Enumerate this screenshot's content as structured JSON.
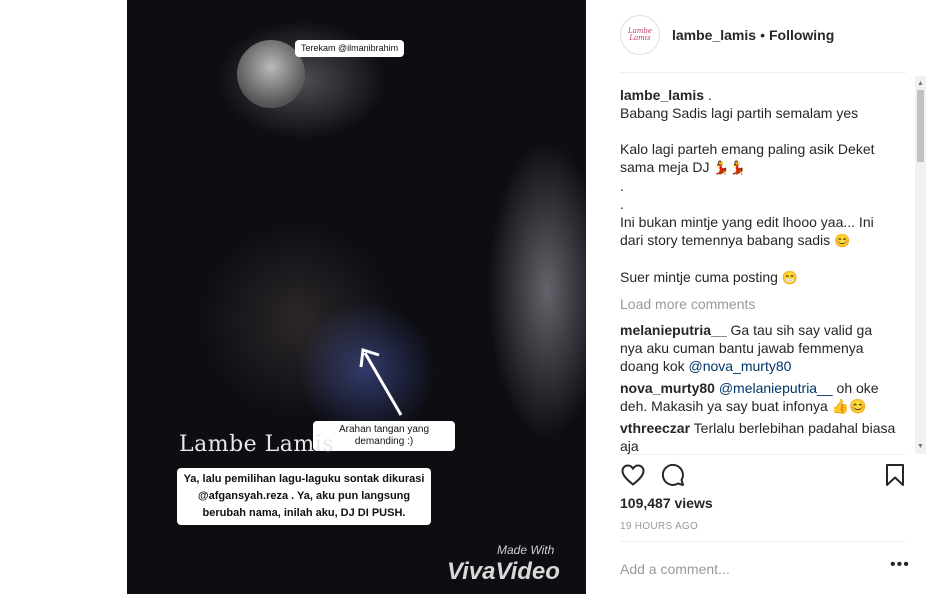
{
  "video": {
    "tag_top": "Terekam @ilmanibrahim",
    "arrow_note": "Arahan tangan yang demanding :)",
    "brand_overlay": "Lambe Lamis",
    "caption": "Ya, lalu pemilihan lagu-laguku sontak dikurasi @afgansyah.reza . Ya, aku pun langsung berubah nama, inilah aku, DJ DI PUSH.",
    "watermark_small": "Made With",
    "watermark_big": "VivaVideo"
  },
  "header": {
    "avatar_text": "Lambe Lamis",
    "username": "lambe_lamis",
    "separator": "•",
    "follow_status": "Following"
  },
  "post_caption": {
    "username": "lambe_lamis",
    "first_line": " .",
    "lines": [
      "Babang Sadis lagi partih semalam yes",
      "",
      "Kalo lagi parteh emang paling asik Deket sama meja DJ",
      ".",
      ".",
      "Ini bukan mintje yang edit lhooo yaa... Ini dari story temennya babang sadis",
      "",
      "Suer mintje cuma posting"
    ],
    "emoji_dj": "💃💃",
    "emoji_smile": "😊",
    "emoji_cheeky": "😁"
  },
  "load_more": "Load more comments",
  "comments": [
    {
      "user": "melanieputria__",
      "text": " Ga tau sih say valid ga nya aku cuman bantu jawab femmenya doang kok ",
      "mention": "@nova_murty80",
      "tail": ""
    },
    {
      "user": "nova_murty80",
      "text": " ",
      "mention": "@melanieputria__",
      "tail": " oh oke deh. Makasih ya say buat infonya 👍😊"
    },
    {
      "user": "vthreeczar",
      "text": " Terlalu berlebihan padahal biasa aja",
      "mention": "",
      "tail": ""
    }
  ],
  "actions": {
    "like": "heart-icon",
    "comment": "comment-icon",
    "save": "bookmark-icon"
  },
  "views": "109,487 views",
  "age": "19 HOURS AGO",
  "add_comment_placeholder": "Add a comment...",
  "more_options": "•••"
}
